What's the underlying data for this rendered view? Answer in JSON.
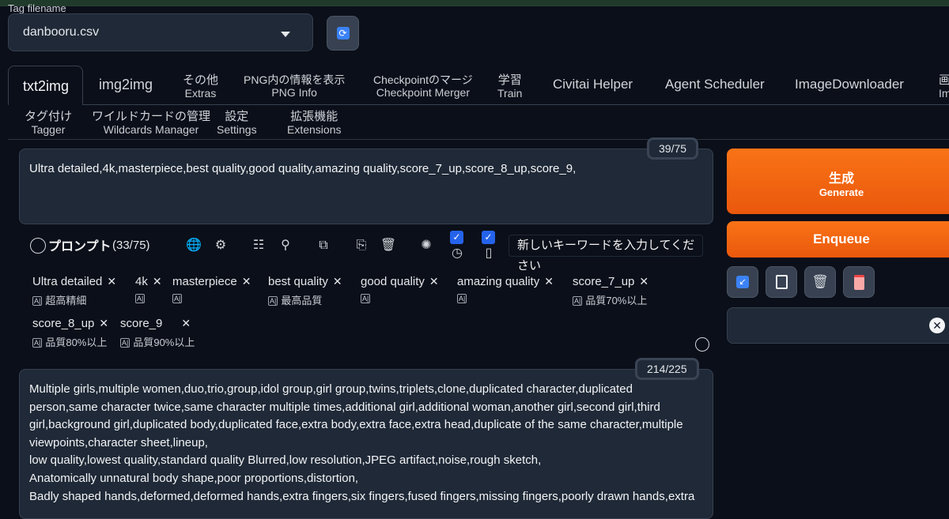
{
  "tag_file": {
    "label": "Tag filename",
    "value": "danbooru.csv"
  },
  "tabs_row1": [
    {
      "main": "txt2img",
      "sub": ""
    },
    {
      "main": "img2img",
      "sub": ""
    },
    {
      "main": "その他",
      "sub": "Extras"
    },
    {
      "main": "PNG内の情報を表示",
      "sub": "PNG Info"
    },
    {
      "main": "Checkpointのマージ",
      "sub": "Checkpoint Merger"
    },
    {
      "main": "学習",
      "sub": "Train"
    },
    {
      "main": "Civitai Helper",
      "sub": ""
    },
    {
      "main": "Agent Scheduler",
      "sub": ""
    },
    {
      "main": "ImageDownloader",
      "sub": ""
    },
    {
      "main": "画",
      "sub": "Im"
    }
  ],
  "tabs_row2": [
    {
      "main": "タグ付け",
      "sub": "Tagger"
    },
    {
      "main": "ワイルドカードの管理",
      "sub": "Wildcards Manager"
    },
    {
      "main": "設定",
      "sub": "Settings"
    },
    {
      "main": "拡張機能",
      "sub": "Extensions"
    }
  ],
  "prompt": {
    "text": "Ultra detailed,4k,masterpiece,best quality,good quality,amazing quality,score_7_up,score_8_up,score_9,",
    "counter": "39/75"
  },
  "generate": {
    "label_ja": "生成",
    "label_en": "Generate"
  },
  "enqueue": {
    "label": "Enqueue"
  },
  "tag_toolbar": {
    "title": "プロンプト",
    "count": "(33/75)",
    "keyword_placeholder": "新しいキーワードを入力してください"
  },
  "tags": [
    {
      "name": "Ultra detailed",
      "translation": "超高精細"
    },
    {
      "name": "4k",
      "translation": ""
    },
    {
      "name": "masterpiece",
      "translation": ""
    },
    {
      "name": "best quality",
      "translation": "最高品質"
    },
    {
      "name": "good quality",
      "translation": ""
    },
    {
      "name": "amazing quality",
      "translation": ""
    },
    {
      "name": "score_7_up",
      "translation": "品質70%以上"
    },
    {
      "name": "score_8_up",
      "translation": "品質80%以上"
    },
    {
      "name": "score_9",
      "translation": "品質90%以上"
    }
  ],
  "negative_prompt": {
    "counter": "214/225",
    "lines": [
      "Multiple girls,multiple women,duo,trio,group,idol group,girl group,twins,triplets,clone,duplicated character,duplicated",
      "person,same character twice,same character multiple times,additional girl,additional woman,another girl,second girl,third",
      "girl,background girl,duplicated body,duplicated face,extra body,extra face,extra head,duplicate of the same character,multiple",
      "viewpoints,character sheet,lineup,",
      "low quality,lowest quality,standard quality Blurred,low resolution,JPEG artifact,noise,rough sketch,",
      "Anatomically unnatural body shape,poor proportions,distortion,",
      "Badly shaped hands,deformed,deformed hands,extra fingers,six fingers,fused fingers,missing fingers,poorly drawn hands,extra"
    ]
  },
  "colors": {
    "accent": "#f97316",
    "background": "#0b0f19",
    "panel": "#1f2937",
    "checkbox": "#2563eb"
  }
}
